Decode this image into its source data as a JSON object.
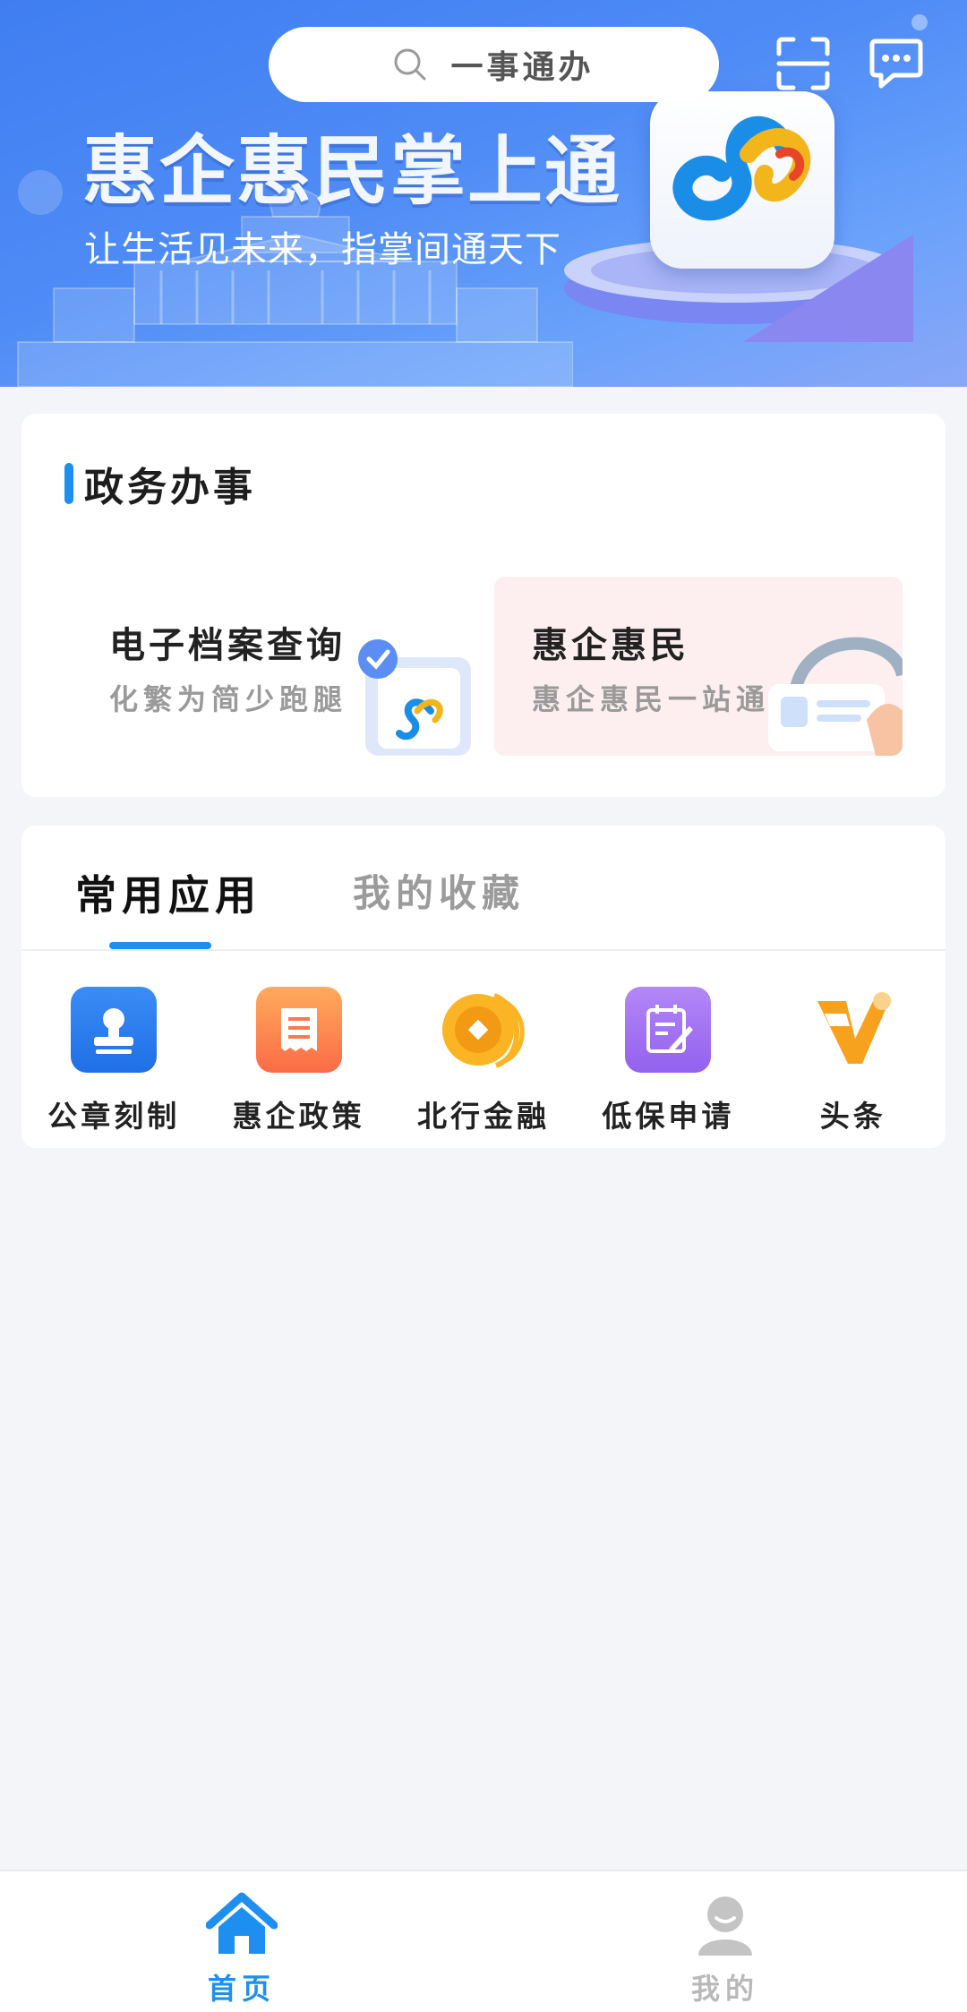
{
  "header": {
    "search_placeholder": "一事通办",
    "banner_title": "惠企惠民掌上通",
    "banner_subtitle": "让生活见未来，指掌间通天下",
    "scan_icon": "scan-icon",
    "message_icon": "message-icon"
  },
  "government": {
    "title": "政务办事",
    "services": [
      {
        "title": "电子档案查询",
        "subtitle": "化繁为简少跑腿"
      },
      {
        "title": "惠企惠民",
        "subtitle": "惠企惠民一站通"
      }
    ]
  },
  "apps_section": {
    "tabs": [
      "常用应用",
      "我的收藏"
    ],
    "active_tab": 0,
    "apps": [
      {
        "label": "公章刻制",
        "icon": "seal-icon",
        "color": "#2f7cf0"
      },
      {
        "label": "惠企政策",
        "icon": "document-icon",
        "color": "#fb7a4a"
      },
      {
        "label": "北行金融",
        "icon": "coin-icon",
        "color": "#f5a31a"
      },
      {
        "label": "低保申请",
        "icon": "application-form-icon",
        "color": "#a16ff0"
      },
      {
        "label": "头条",
        "icon": "headline-icon",
        "color": "#f5a31a"
      }
    ]
  },
  "bottom_nav": {
    "items": [
      {
        "label": "首页",
        "icon": "home-icon",
        "active": true
      },
      {
        "label": "我的",
        "icon": "user-icon",
        "active": false
      }
    ],
    "active_color": "#1d8ff0",
    "inactive_color": "#b9b9b9"
  }
}
